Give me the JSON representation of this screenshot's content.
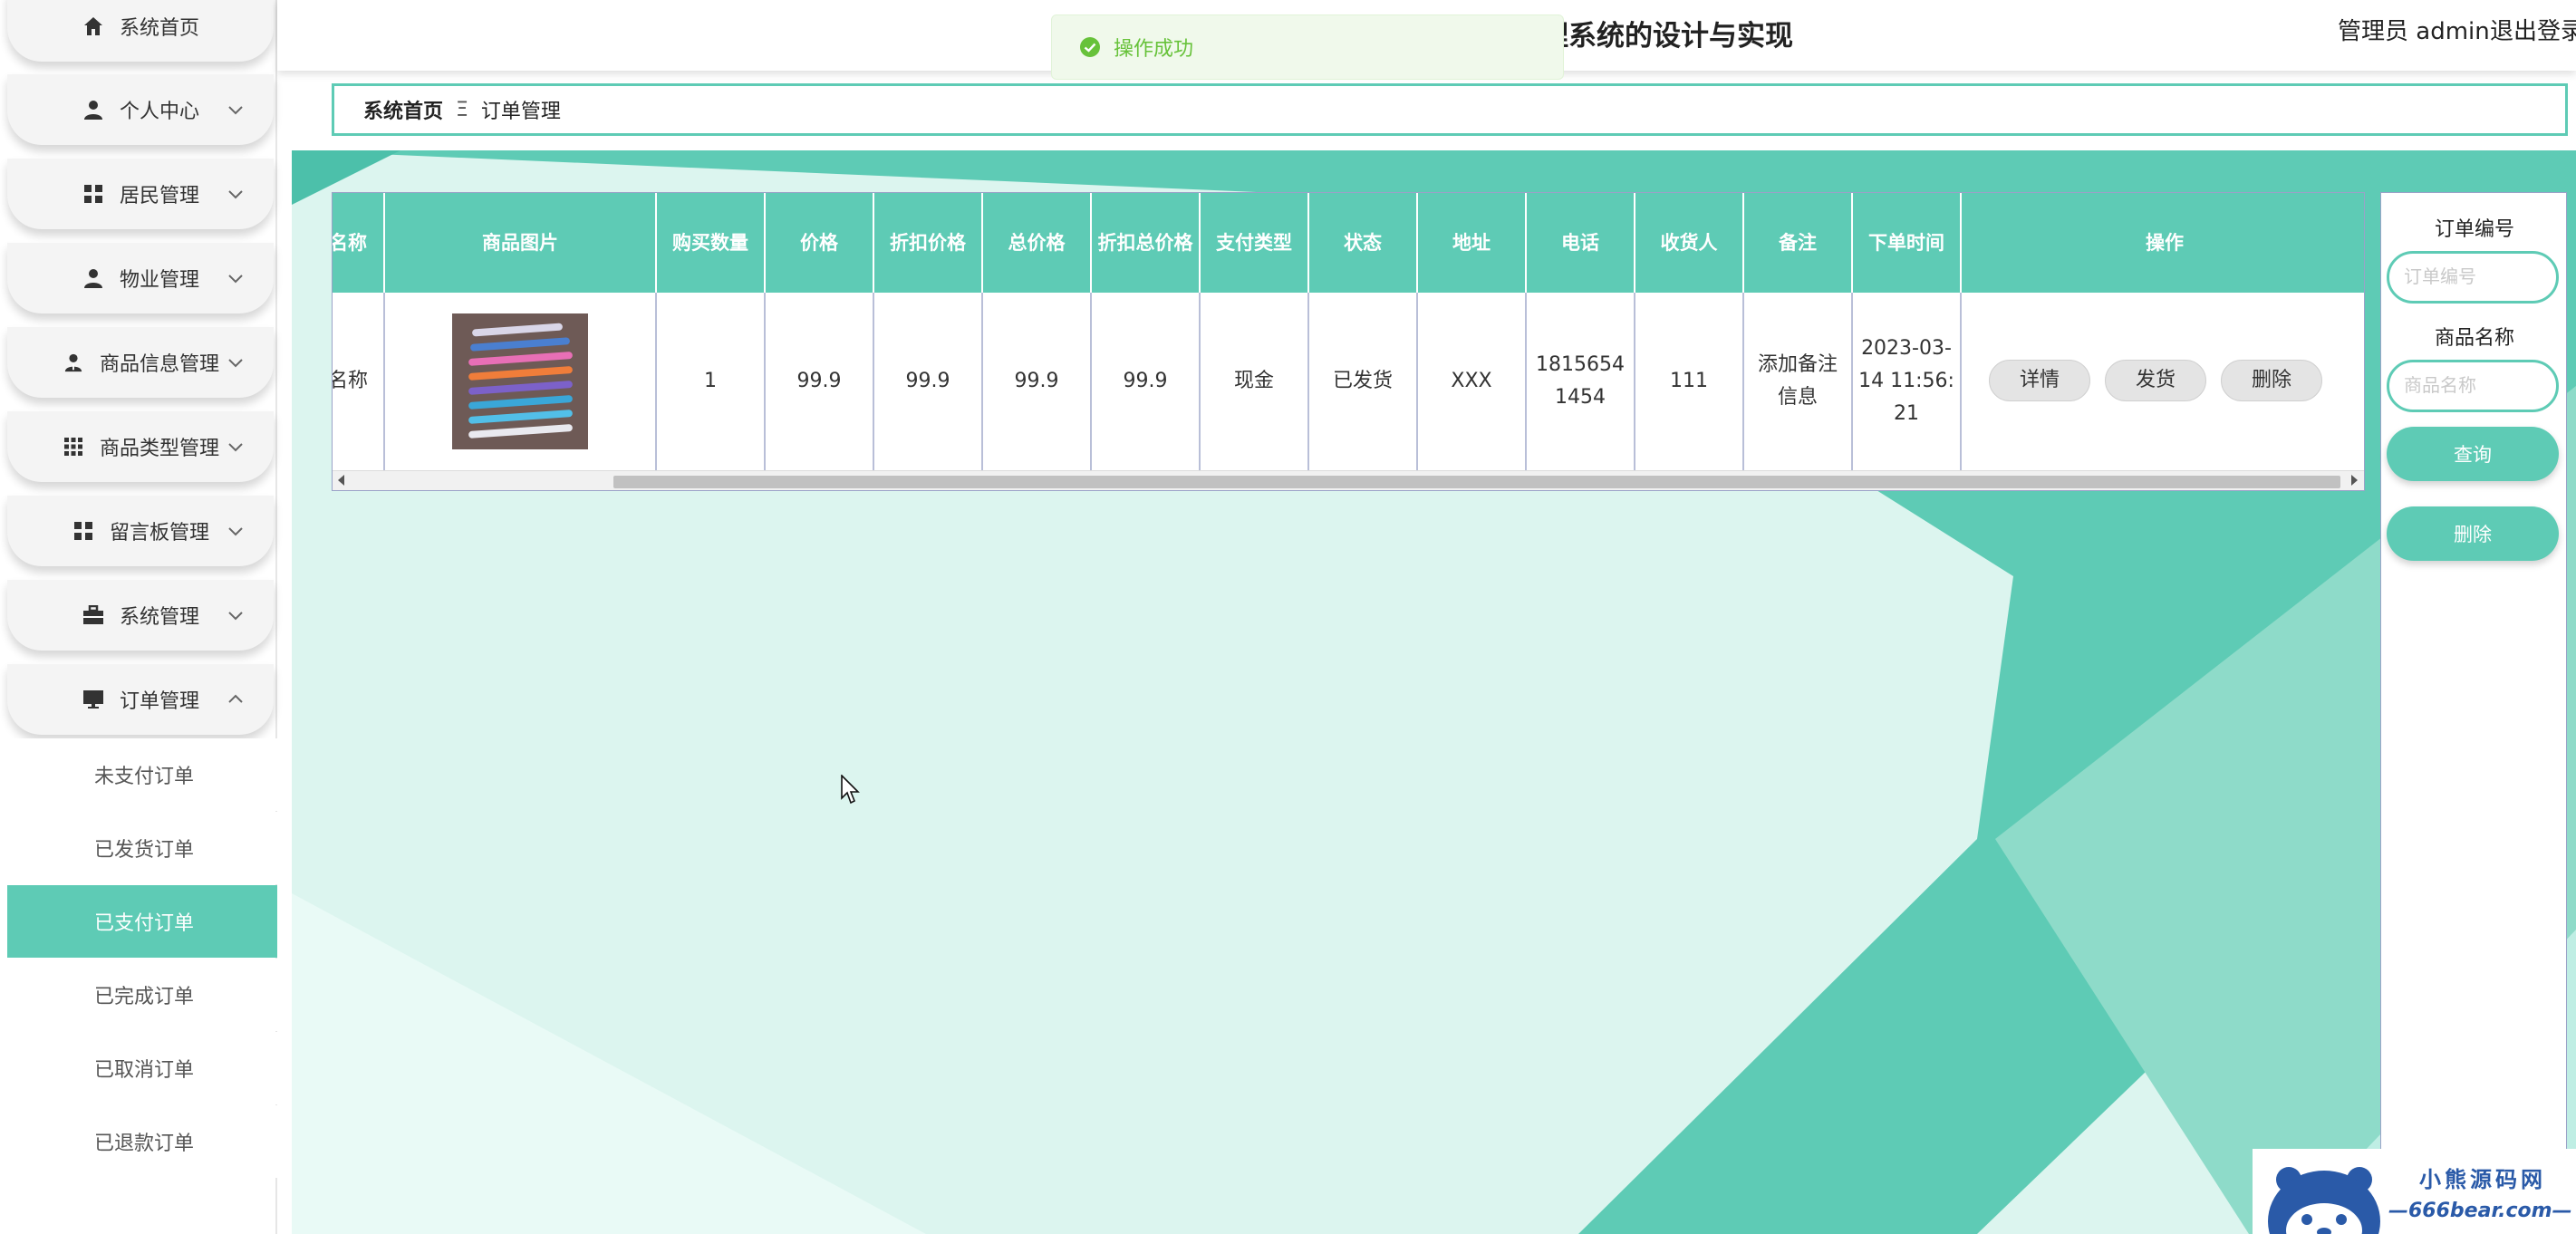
{
  "header": {
    "title": "理系统的设计与实现",
    "user": "管理员 admin",
    "logout": "退出登录"
  },
  "toast": {
    "message": "操作成功"
  },
  "sidebar": {
    "items": [
      {
        "label": "系统首页",
        "icon": "home-icon"
      },
      {
        "label": "个人中心",
        "icon": "user-icon"
      },
      {
        "label": "居民管理",
        "icon": "grid-icon"
      },
      {
        "label": "物业管理",
        "icon": "user-icon"
      },
      {
        "label": "商品信息管理",
        "icon": "user-tie-icon"
      },
      {
        "label": "商品类型管理",
        "icon": "grid-nine-icon"
      },
      {
        "label": "留言板管理",
        "icon": "grid-icon"
      },
      {
        "label": "系统管理",
        "icon": "briefcase-icon"
      },
      {
        "label": "订单管理",
        "icon": "monitor-icon"
      }
    ],
    "sub_items": [
      {
        "label": "未支付订单",
        "active": false
      },
      {
        "label": "已发货订单",
        "active": false
      },
      {
        "label": "已支付订单",
        "active": true
      },
      {
        "label": "已完成订单",
        "active": false
      },
      {
        "label": "已取消订单",
        "active": false
      },
      {
        "label": "已退款订单",
        "active": false
      }
    ]
  },
  "breadcrumb": {
    "home": "系统首页",
    "separator": "Ξ",
    "current": "订单管理"
  },
  "table": {
    "headers": [
      "名称",
      "商品图片",
      "购买数量",
      "价格",
      "折扣价格",
      "总价格",
      "折扣总价格",
      "支付类型",
      "状态",
      "地址",
      "电话",
      "收货人",
      "备注",
      "下单时间",
      "操作"
    ],
    "row": {
      "name": "名称",
      "quantity": "1",
      "price": "99.9",
      "discount_price": "99.9",
      "total_price": "99.9",
      "discount_total": "99.9",
      "pay_type": "现金",
      "status": "已发货",
      "address": "XXX",
      "phone": "18156541454",
      "receiver": "111",
      "remark": "添加备注信息",
      "order_time": "2023-03-14 11:56:21"
    },
    "actions": [
      "详情",
      "发货",
      "删除"
    ]
  },
  "search": {
    "order_no_label": "订单编号",
    "order_no_placeholder": "订单编号",
    "product_name_label": "商品名称",
    "product_name_placeholder": "商品名称",
    "query_button": "查询",
    "delete_button": "删除"
  },
  "watermark": {
    "name": "小熊源码网",
    "url": "—666bear.com—"
  },
  "colors": {
    "accent": "#5ecbb5",
    "active_bg": "#5ecbb5",
    "toast_text": "#67c23a"
  }
}
